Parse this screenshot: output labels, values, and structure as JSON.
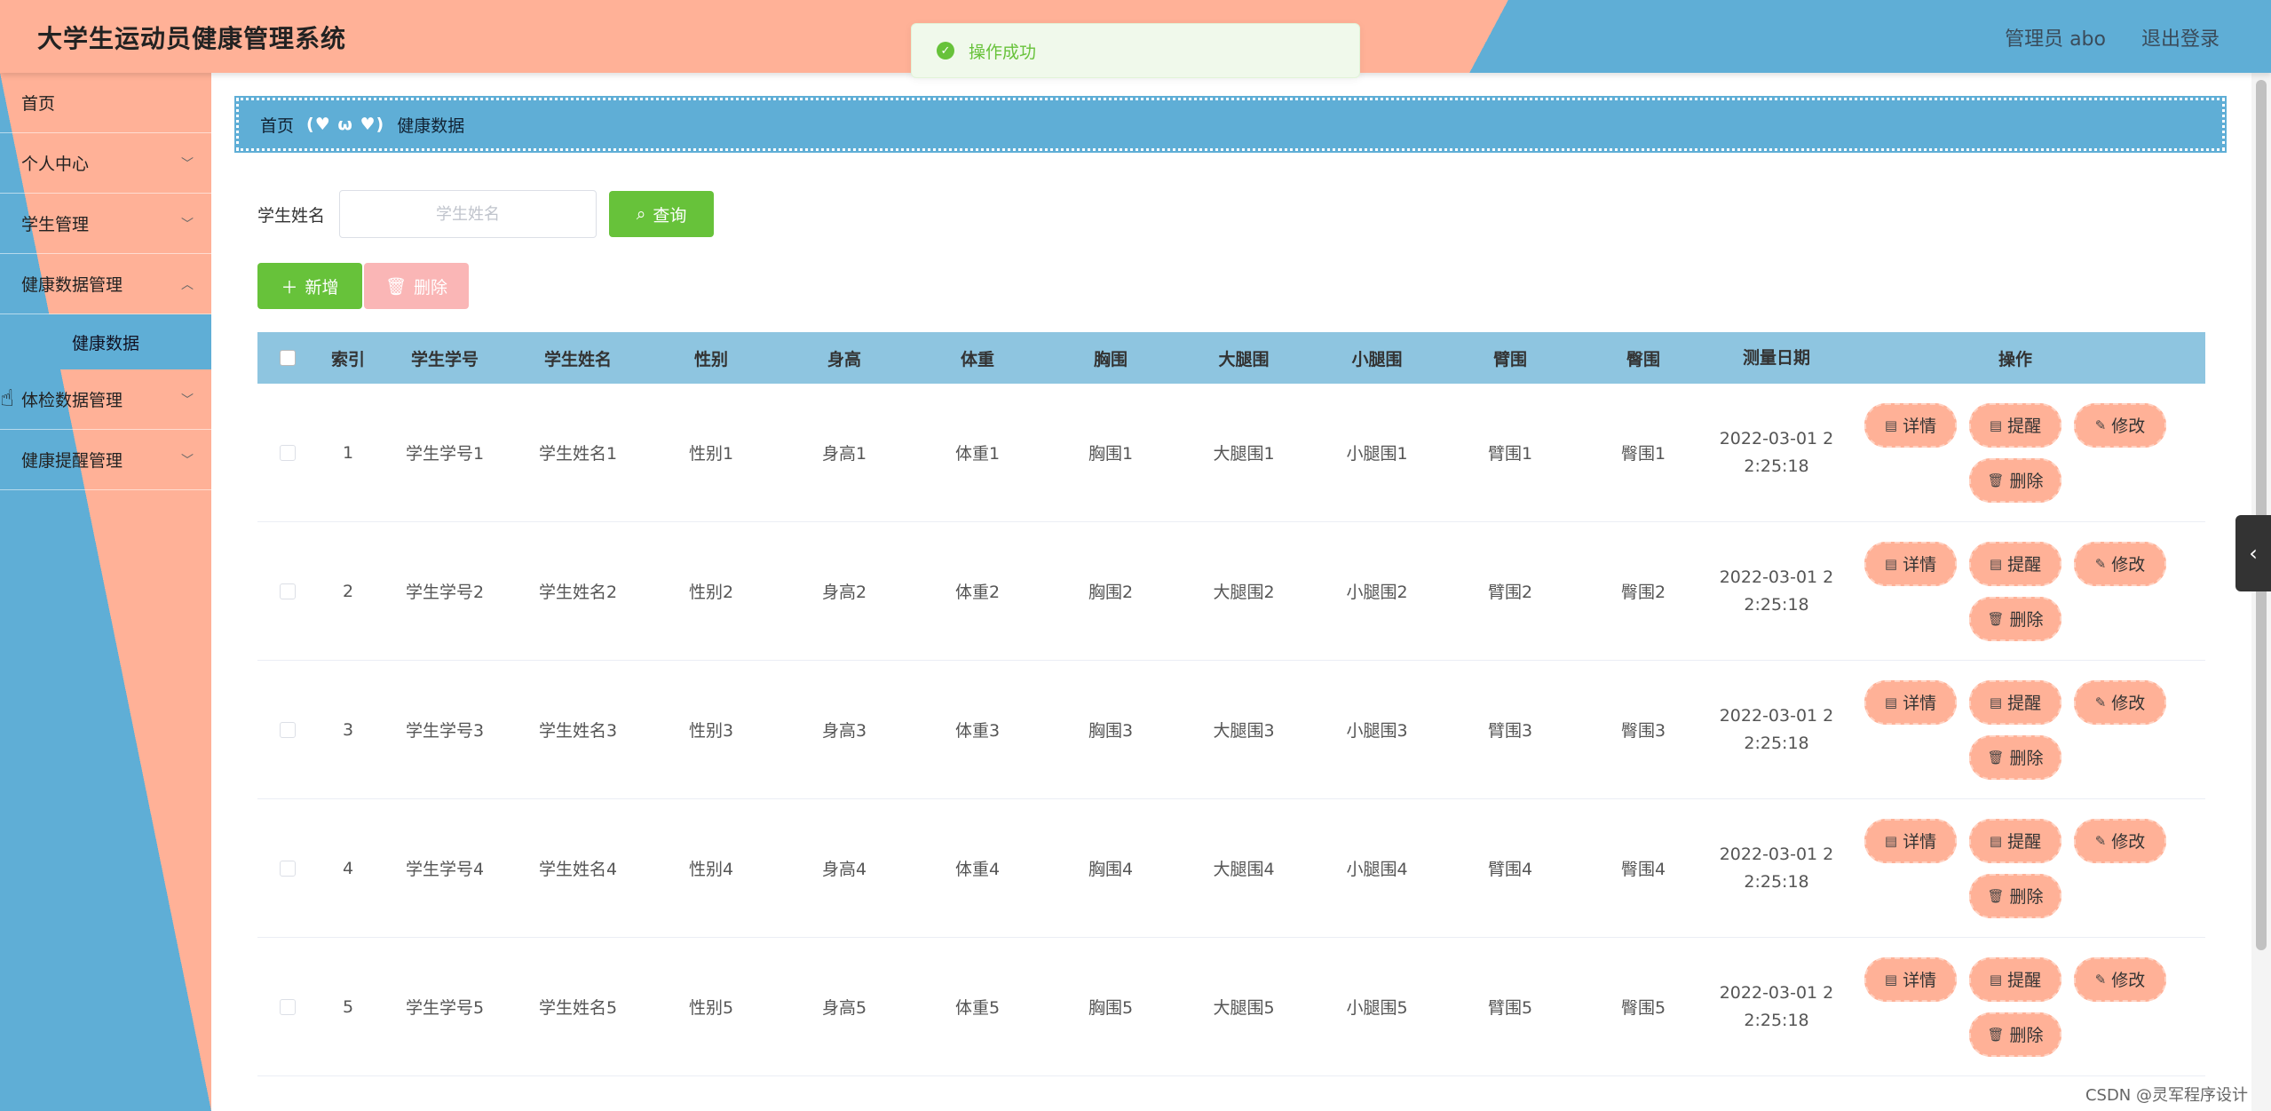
{
  "header": {
    "title": "大学生运动员健康管理系统",
    "user_label": "管理员 abo",
    "logout_label": "退出登录"
  },
  "toast": {
    "message": "操作成功"
  },
  "sidebar": {
    "items": [
      {
        "label": "首页"
      },
      {
        "label": "个人中心"
      },
      {
        "label": "学生管理"
      },
      {
        "label": "健康数据管理"
      },
      {
        "label": "体检数据管理"
      },
      {
        "label": "健康提醒管理"
      }
    ],
    "active_sub": "健康数据"
  },
  "breadcrumb": {
    "home": "首页",
    "separator": "(♥ ω ♥)",
    "current": "健康数据"
  },
  "search": {
    "label": "学生姓名",
    "placeholder": "学生姓名",
    "query_label": "查询"
  },
  "actions": {
    "add_label": "新增",
    "delete_label": "删除"
  },
  "table": {
    "headers": [
      "索引",
      "学生学号",
      "学生姓名",
      "性别",
      "身高",
      "体重",
      "胸围",
      "大腿围",
      "小腿围",
      "臂围",
      "臀围",
      "测量日期",
      "操作"
    ],
    "rows": [
      {
        "idx": "1",
        "no": "学生学号1",
        "name": "学生姓名1",
        "sex": "性别1",
        "h": "身高1",
        "w": "体重1",
        "chest": "胸围1",
        "thigh": "大腿围1",
        "calf": "小腿围1",
        "arm": "臂围1",
        "hip": "臀围1",
        "date": "2022-03-01 22:25:18"
      },
      {
        "idx": "2",
        "no": "学生学号2",
        "name": "学生姓名2",
        "sex": "性别2",
        "h": "身高2",
        "w": "体重2",
        "chest": "胸围2",
        "thigh": "大腿围2",
        "calf": "小腿围2",
        "arm": "臂围2",
        "hip": "臀围2",
        "date": "2022-03-01 22:25:18"
      },
      {
        "idx": "3",
        "no": "学生学号3",
        "name": "学生姓名3",
        "sex": "性别3",
        "h": "身高3",
        "w": "体重3",
        "chest": "胸围3",
        "thigh": "大腿围3",
        "calf": "小腿围3",
        "arm": "臂围3",
        "hip": "臀围3",
        "date": "2022-03-01 22:25:18"
      },
      {
        "idx": "4",
        "no": "学生学号4",
        "name": "学生姓名4",
        "sex": "性别4",
        "h": "身高4",
        "w": "体重4",
        "chest": "胸围4",
        "thigh": "大腿围4",
        "calf": "小腿围4",
        "arm": "臂围4",
        "hip": "臀围4",
        "date": "2022-03-01 22:25:18"
      },
      {
        "idx": "5",
        "no": "学生学号5",
        "name": "学生姓名5",
        "sex": "性别5",
        "h": "身高5",
        "w": "体重5",
        "chest": "胸围5",
        "thigh": "大腿围5",
        "calf": "小腿围5",
        "arm": "臂围5",
        "hip": "臀围5",
        "date": "2022-03-01 22:25:18"
      }
    ],
    "ops": {
      "detail": "详情",
      "remind": "提醒",
      "edit": "修改",
      "delete": "删除"
    }
  },
  "watermark": "CSDN @灵军程序设计"
}
